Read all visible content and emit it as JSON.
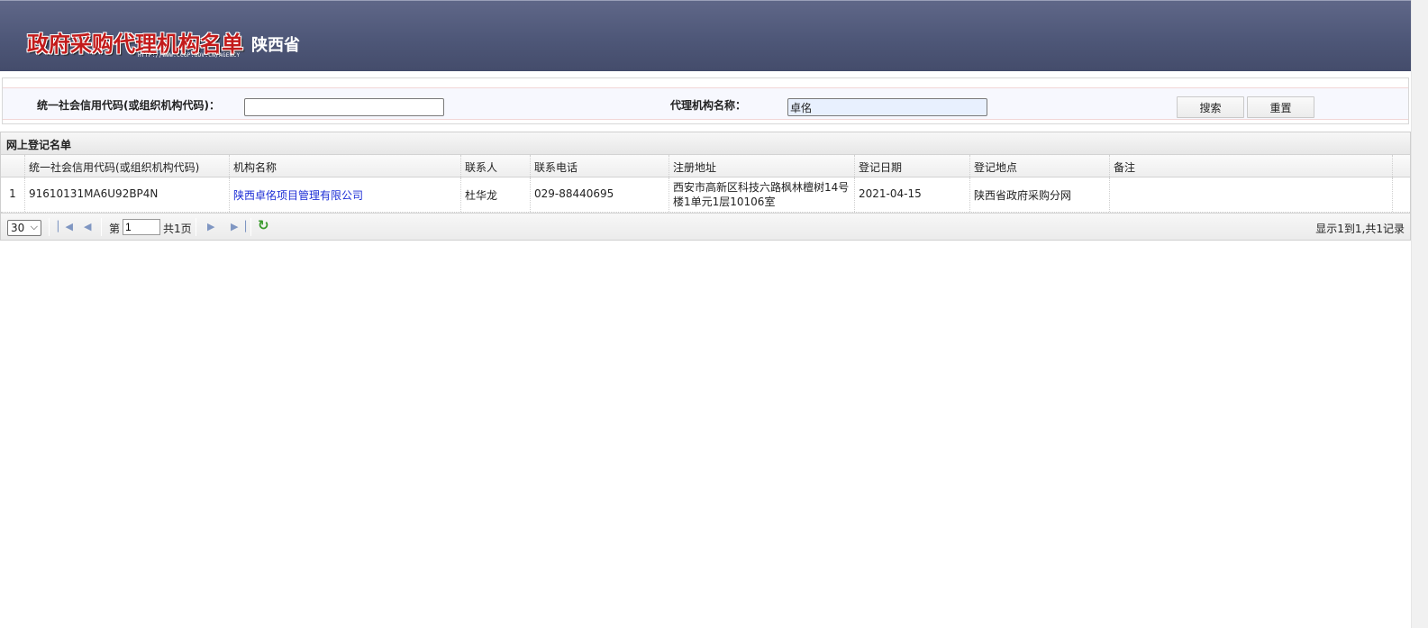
{
  "header": {
    "title": "政府采购代理机构名单",
    "url": "HTTP://WWW.CCGP.GOV.CN/AGENCY",
    "province": "陕西省"
  },
  "search": {
    "code_label": "统一社会信用代码(或组织机构代码)：",
    "code_value": "",
    "name_label": "代理机构名称：",
    "name_value": "卓佲",
    "search_button": "搜索",
    "reset_button": "重置"
  },
  "grid": {
    "title": "网上登记名单",
    "columns": [
      "统一社会信用代码(或组织机构代码)",
      "机构名称",
      "联系人",
      "联系电话",
      "注册地址",
      "登记日期",
      "登记地点",
      "备注"
    ],
    "rows": [
      {
        "index": "1",
        "code": "91610131MA6U92BP4N",
        "name": "陕西卓佲项目管理有限公司",
        "contact": "杜华龙",
        "phone": "029-88440695",
        "address": "西安市高新区科技六路枫林檀树14号楼1单元1层10106室",
        "date": "2021-04-15",
        "place": "陕西省政府采购分网",
        "remark": ""
      }
    ]
  },
  "pager": {
    "page_size": "30",
    "page_prefix": "第",
    "page_value": "1",
    "page_total": "共1页",
    "info": "显示1到1,共1记录"
  },
  "icons": {
    "first": "first-page-icon",
    "prev": "prev-page-icon",
    "next": "next-page-icon",
    "last": "last-page-icon",
    "refresh": "refresh-icon"
  }
}
